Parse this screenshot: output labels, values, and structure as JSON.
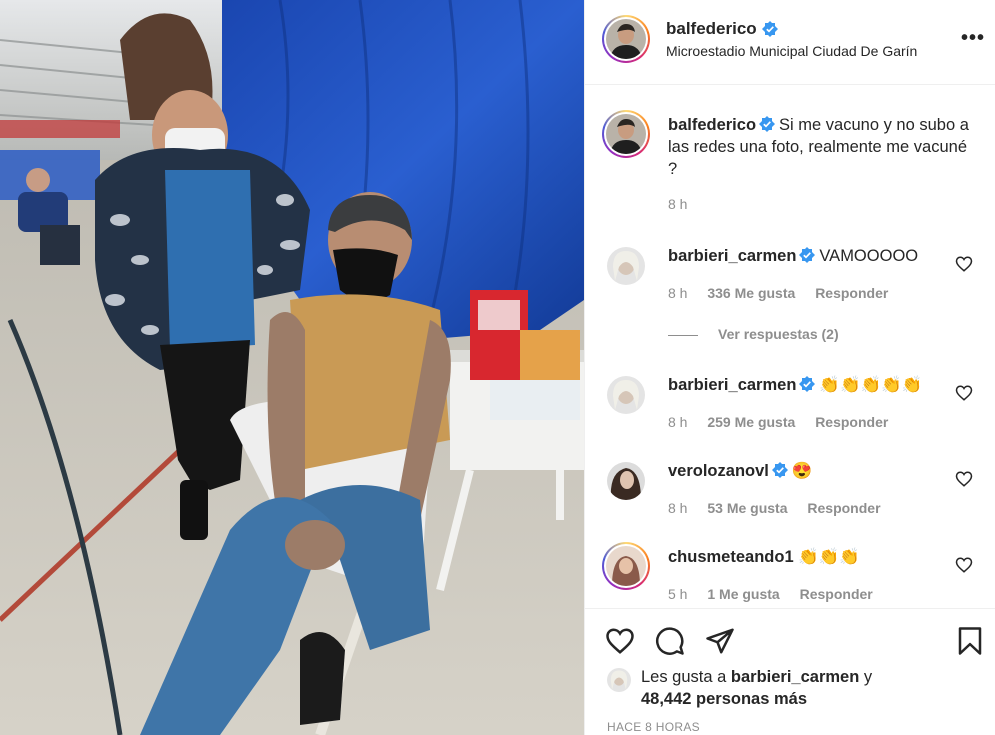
{
  "post": {
    "author": "balfederico",
    "location": "Microestadio Municipal Ciudad De Garín",
    "more_label": "•••",
    "caption": {
      "username": "balfederico",
      "text_line": "Si me vacuno y no subo a las redes una foto, realmente me vacuné ?",
      "time": "8 h"
    }
  },
  "comments": [
    {
      "username": "barbieri_carmen",
      "verified": true,
      "text": "VAMOOOOO",
      "time": "8 h",
      "likes": "336 Me gusta",
      "reply": "Responder"
    },
    {
      "username": "barbieri_carmen",
      "verified": true,
      "text": "👏👏👏👏👏",
      "time": "8 h",
      "likes": "259 Me gusta",
      "reply": "Responder"
    },
    {
      "username": "verolozanovl",
      "verified": true,
      "text": "😍",
      "time": "8 h",
      "likes": "53 Me gusta",
      "reply": "Responder"
    },
    {
      "username": "chusmeteando1",
      "verified": false,
      "text": "👏👏👏",
      "time": "5 h",
      "likes": "1 Me gusta",
      "reply": "Responder"
    }
  ],
  "view_replies": "Ver respuestas (2)",
  "actions": {
    "like_icon": "heart-icon",
    "comment_icon": "comment-icon",
    "share_icon": "send-icon",
    "save_icon": "bookmark-icon"
  },
  "likes": {
    "prefix": "Les gusta a",
    "user": "barbieri_carmen",
    "conjunction": "y",
    "count_text": "48,442 personas más"
  },
  "posted": "HACE 8 HORAS",
  "colors": {
    "verified": "#3897f0",
    "text": "#262626",
    "muted": "#8e8e8e",
    "tarp": "#1f4fb8"
  }
}
